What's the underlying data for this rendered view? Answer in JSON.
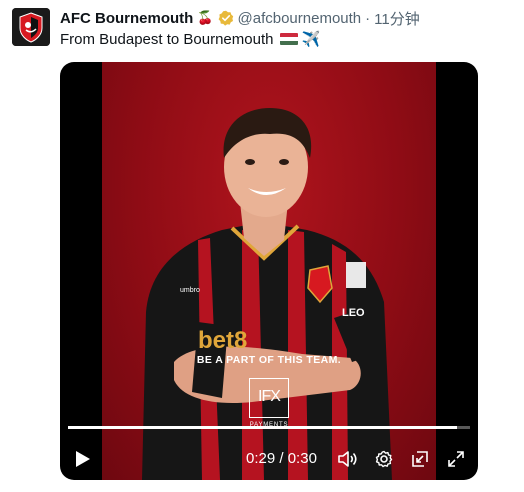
{
  "account": {
    "name": "AFC Bournemouth",
    "name_emoji": "🍒",
    "handle": "@afcbournemouth",
    "separator": "·",
    "time_ago": "11分钟"
  },
  "tweet": {
    "text": "From Budapest to Bournemouth",
    "emoji_flag": "hungary-flag",
    "emoji_plane": "✈️"
  },
  "video": {
    "tagline": "BE A PART OF THIS TEAM.",
    "partner_logo": "IFX",
    "partner_sub": "PAYMENTS",
    "current_time": "0:29",
    "time_separator": " / ",
    "duration": "0:30",
    "progress": 0.967
  },
  "icons": {
    "play": "play-icon",
    "volume": "volume-icon",
    "settings": "settings-gear-icon",
    "pip": "picture-in-picture-icon",
    "fullscreen": "fullscreen-icon"
  },
  "colors": {
    "accent_red": "#b0141d",
    "text": "#0f1419",
    "muted": "#536471",
    "verified_gold": "#e8b93a"
  }
}
